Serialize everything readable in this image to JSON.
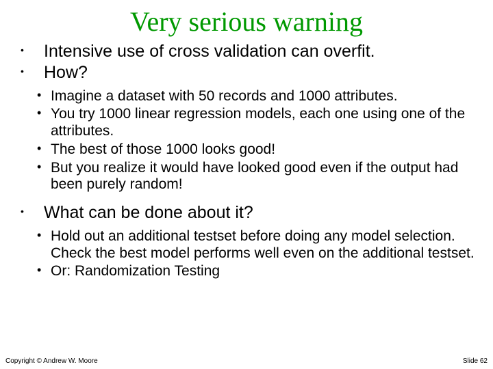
{
  "title": "Very serious warning",
  "bullets": {
    "b0": "Intensive use of cross validation can overfit.",
    "b1": "How?",
    "b2": "What can be done about it?"
  },
  "sub1": {
    "s0": "Imagine a dataset with 50 records and 1000 attributes.",
    "s1": "You try 1000 linear regression models, each one using one of the attributes.",
    "s2": "The best of those 1000 looks good!",
    "s3": "But you realize it would have looked good even if the output had been purely random!"
  },
  "sub2": {
    "s0": "Hold out an additional testset before doing any model selection. Check the best model performs well even on the additional testset.",
    "s1": "Or: Randomization Testing"
  },
  "footer": {
    "left": "Copyright © Andrew W. Moore",
    "right": "Slide 62"
  }
}
